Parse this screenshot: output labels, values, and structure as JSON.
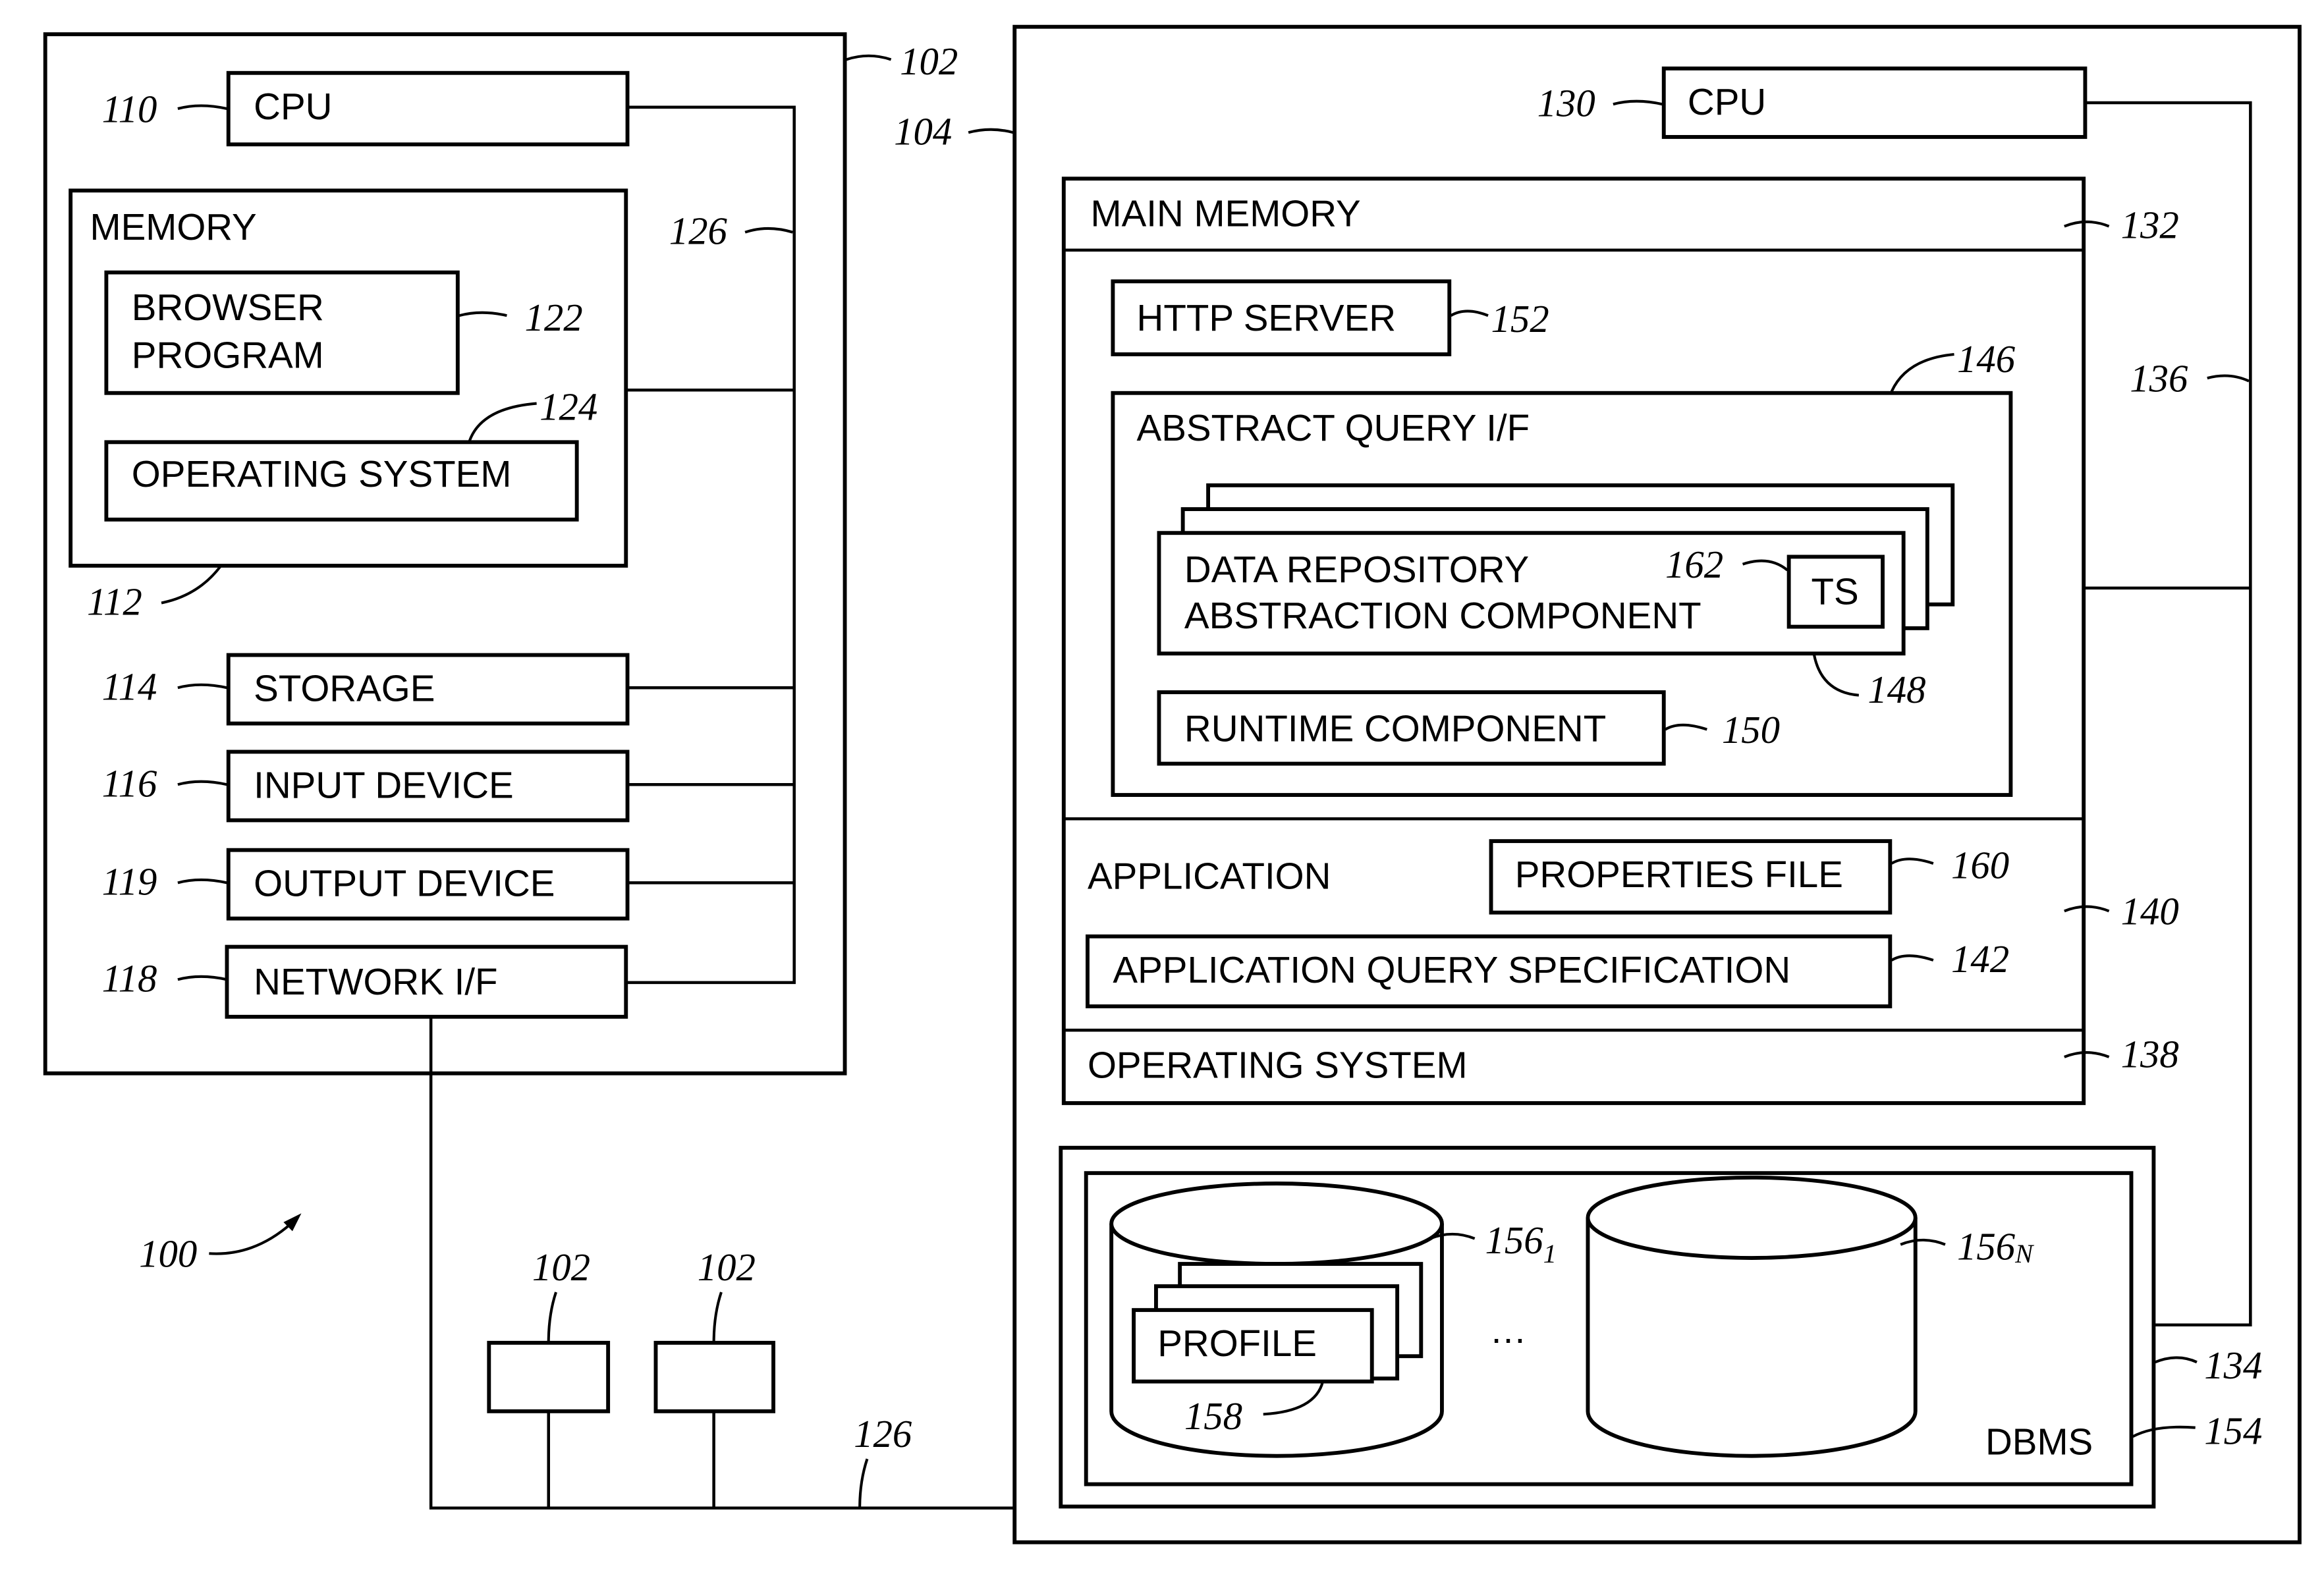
{
  "figure": {
    "overall_ref": "100",
    "client": {
      "ref": "102",
      "cpu": {
        "label": "CPU",
        "ref": "110"
      },
      "memory": {
        "label": "MEMORY",
        "ref": "112",
        "browser": {
          "line1": "BROWSER",
          "line2": "PROGRAM",
          "ref": "122"
        },
        "os": {
          "label": "OPERATING SYSTEM",
          "ref": "124"
        }
      },
      "bus_ref": "126",
      "storage": {
        "label": "STORAGE",
        "ref": "114"
      },
      "input": {
        "label": "INPUT DEVICE",
        "ref": "116"
      },
      "output": {
        "label": "OUTPUT DEVICE",
        "ref": "119"
      },
      "network": {
        "label": "NETWORK I/F",
        "ref": "118"
      }
    },
    "other_clients": [
      {
        "ref": "102"
      },
      {
        "ref": "102"
      }
    ],
    "network_ref": "126",
    "server": {
      "ref": "104",
      "cpu": {
        "label": "CPU",
        "ref": "130"
      },
      "bus_ref": "136",
      "main_memory": {
        "label": "MAIN MEMORY",
        "ref": "132"
      },
      "http_server": {
        "label": "HTTP SERVER",
        "ref": "152"
      },
      "abstract_query": {
        "label": "ABSTRACT QUERY I/F",
        "ref": "146"
      },
      "data_repo": {
        "line1": "DATA REPOSITORY",
        "line2": "ABSTRACTION COMPONENT",
        "ref": "148"
      },
      "ts": {
        "label": "TS",
        "ref": "162"
      },
      "runtime": {
        "label": "RUNTIME COMPONENT",
        "ref": "150"
      },
      "application": {
        "label": "APPLICATION",
        "ref": "140"
      },
      "properties_file": {
        "label": "PROPERTIES FILE",
        "ref": "160"
      },
      "app_query_spec": {
        "label": "APPLICATION QUERY SPECIFICATION",
        "ref": "142"
      },
      "os": {
        "label": "OPERATING SYSTEM",
        "ref": "138"
      },
      "storage_ref": "134",
      "dbms": {
        "label": "DBMS",
        "ref": "154"
      },
      "db1": {
        "ref": "156",
        "sub": "1"
      },
      "dbn": {
        "ref": "156",
        "sub": "N"
      },
      "ellipsis": "…",
      "profile": {
        "label": "PROFILE",
        "ref": "158"
      }
    }
  }
}
